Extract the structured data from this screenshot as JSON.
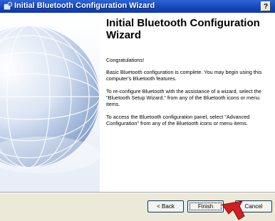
{
  "window": {
    "title": "Initial Bluetooth Configuration Wizard",
    "help_label": "?"
  },
  "main": {
    "heading": "Initial Bluetooth Configuration Wizard",
    "congrats": "Congratulations!",
    "para1": "Basic Bluetooth configuration is complete.  You may begin using this computer's Bluetooth features.",
    "para2": "To re-configure Bluetooth with the assistance of a wizard, select the \"Bluetooth Setup Wizard.\" from any of the Bluetooth icons or menu items.",
    "para3": "To access the Bluetooth configuration panel, select \"Advanced Configuration\" from any of the Bluetooth icons or menu items."
  },
  "buttons": {
    "back": "< Back",
    "finish": "Finish",
    "cancel": "Cancel"
  },
  "colors": {
    "titlebar": "#1446b8",
    "arrow": "#d21f1f"
  },
  "icons": {
    "title": "bluetooth-wizard-icon",
    "help": "help-icon",
    "pointer": "red-arrow-pointer"
  }
}
